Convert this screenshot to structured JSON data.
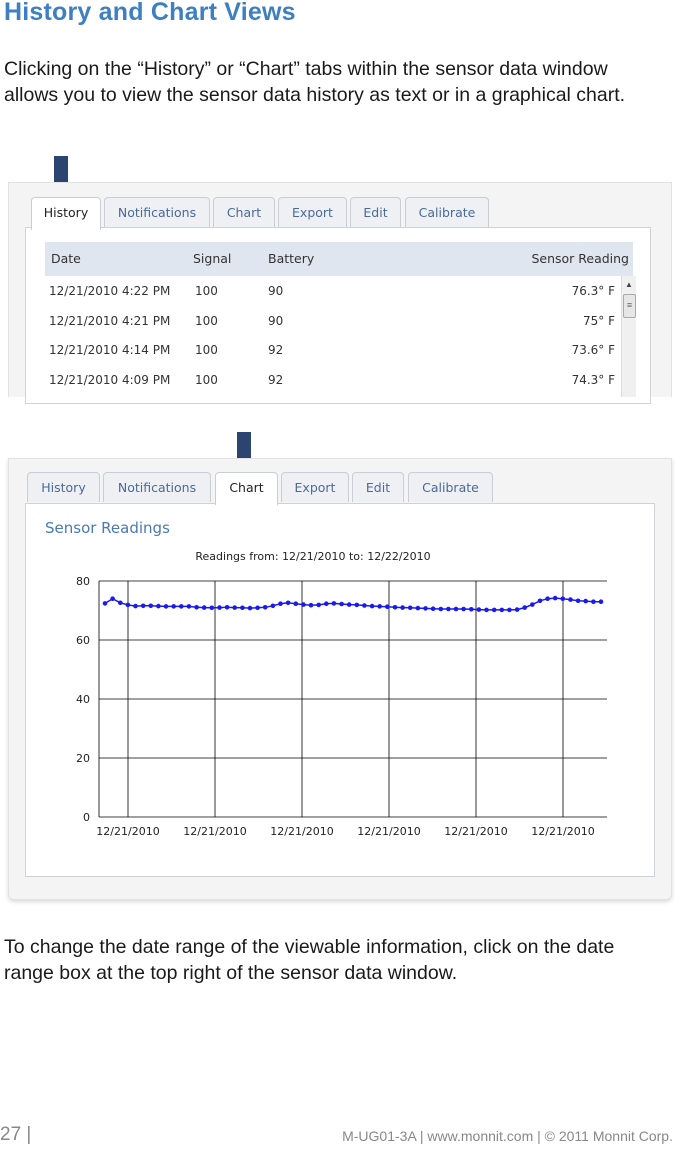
{
  "page": {
    "title": "History and Chart Views",
    "intro": "Clicking on the “History” or “Chart” tabs within the sensor data window allows you to view the sensor data history as text or in a graphical chart.",
    "outro": "To change the date range of the viewable information, click on the date range box at the top right of the sensor data window."
  },
  "tabs": [
    "History",
    "Notifications",
    "Chart",
    "Export",
    "Edit",
    "Calibrate"
  ],
  "history_table": {
    "headers": [
      "Date",
      "Signal",
      "Battery",
      "Sensor Reading"
    ],
    "rows": [
      [
        "12/21/2010 4:22 PM",
        "100",
        "90",
        "76.3° F"
      ],
      [
        "12/21/2010 4:21 PM",
        "100",
        "90",
        "75° F"
      ],
      [
        "12/21/2010 4:14 PM",
        "100",
        "92",
        "73.6° F"
      ],
      [
        "12/21/2010 4:09 PM",
        "100",
        "92",
        "74.3° F"
      ]
    ]
  },
  "chart_panel": {
    "heading": "Sensor Readings"
  },
  "chart_data": {
    "type": "line",
    "title": "Readings from: 12/21/2010 to: 12/22/2010",
    "xlabel": "",
    "ylabel": "",
    "ylim": [
      0,
      80
    ],
    "yticks": [
      "0",
      "20",
      "40",
      "60",
      "80"
    ],
    "xticks": [
      "12/21/2010",
      "12/21/2010",
      "12/21/2010",
      "12/21/2010",
      "12/21/2010",
      "12/21/2010"
    ],
    "grid": true,
    "color": "#1a1aee",
    "series": [
      {
        "values": [
          72.4,
          74.0,
          72.6,
          71.9,
          71.5,
          71.6,
          71.6,
          71.5,
          71.4,
          71.4,
          71.4,
          71.4,
          71.1,
          71.0,
          70.9,
          71.0,
          71.1,
          71.0,
          70.9,
          70.8,
          70.9,
          71.1,
          71.6,
          72.3,
          72.6,
          72.3,
          72.0,
          71.8,
          71.9,
          72.3,
          72.4,
          72.2,
          72.0,
          71.9,
          71.7,
          71.5,
          71.4,
          71.3,
          71.1,
          71.0,
          70.9,
          70.8,
          70.7,
          70.6,
          70.5,
          70.5,
          70.5,
          70.5,
          70.4,
          70.3,
          70.2,
          70.2,
          70.2,
          70.2,
          70.3,
          71.0,
          72.0,
          73.3,
          74.0,
          74.2,
          74.0,
          73.7,
          73.3,
          73.2,
          73.0,
          73.0
        ]
      }
    ]
  },
  "colors": {
    "heading_blue": "#3d7fc1",
    "arrow_navy": "#2b4470",
    "line_blue": "#1a1aee"
  },
  "footer": {
    "page_number": "27 |",
    "meta": "M-UG01-3A | www.monnit.com | © 2011 Monnit Corp."
  }
}
